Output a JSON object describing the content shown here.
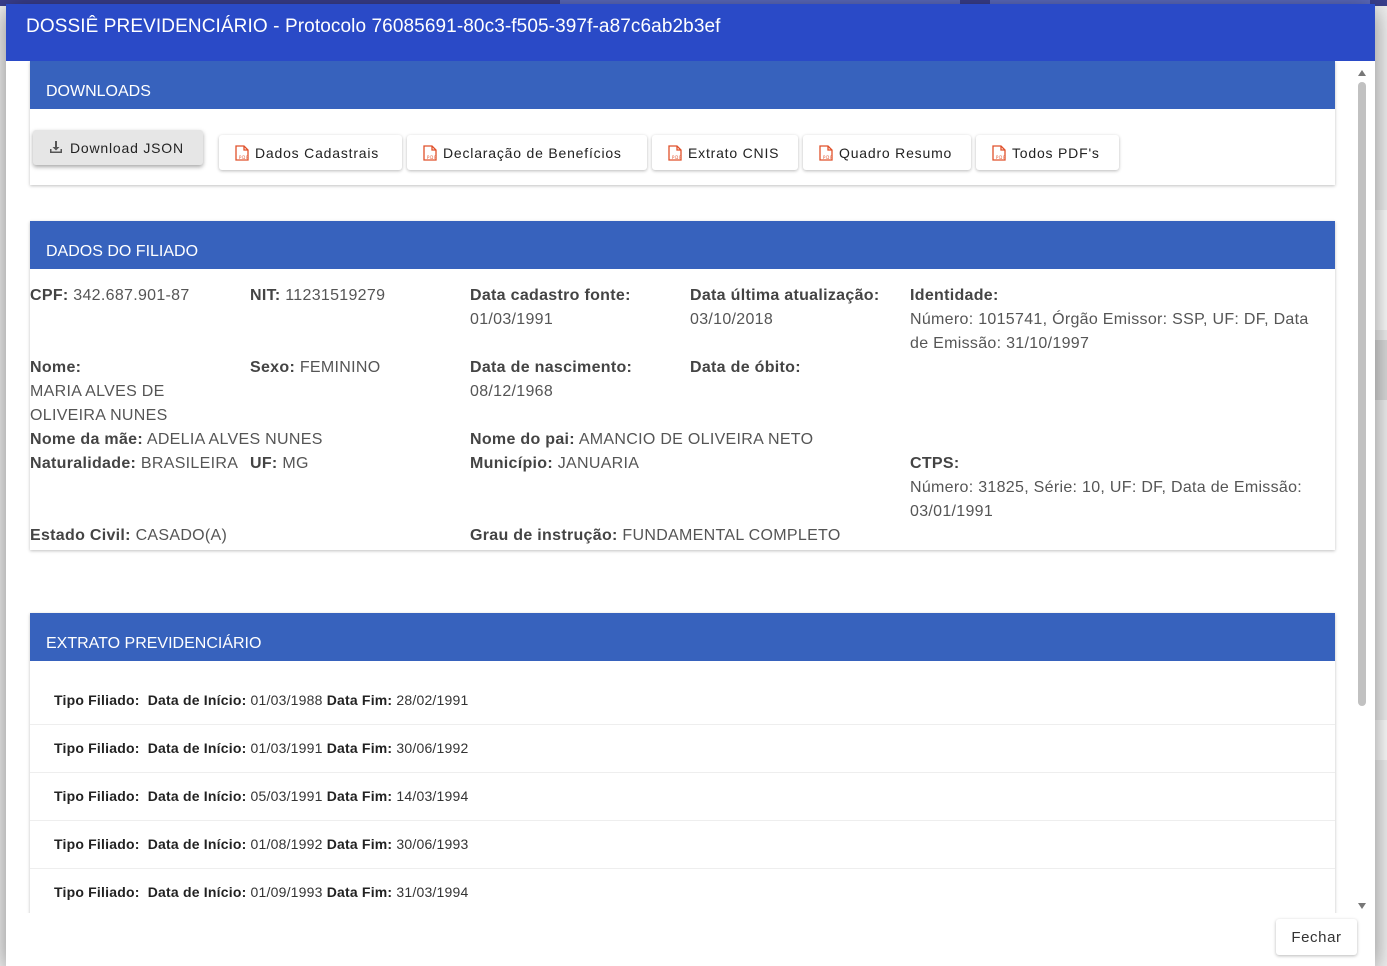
{
  "dialog": {
    "title": "DOSSIÊ PREVIDENCIÁRIO - Protocolo 76085691-80c3-f505-397f-a87c6ab2b3ef",
    "close_label": "Fechar"
  },
  "downloads": {
    "title": "DOWNLOADS",
    "buttons": [
      {
        "label": "Download JSON",
        "icon": "download-icon"
      },
      {
        "label": "Dados Cadastrais",
        "icon": "pdf-icon"
      },
      {
        "label": "Declaração de Benefícios",
        "icon": "pdf-icon"
      },
      {
        "label": "Extrato CNIS",
        "icon": "pdf-icon"
      },
      {
        "label": "Quadro Resumo",
        "icon": "pdf-icon"
      },
      {
        "label": "Todos PDF's",
        "icon": "pdf-icon"
      }
    ]
  },
  "filiado": {
    "title": "DADOS DO FILIADO",
    "cpf": {
      "label": "CPF:",
      "value": "342.687.901-87"
    },
    "nit": {
      "label": "NIT:",
      "value": "11231519279"
    },
    "data_cadastro": {
      "label": "Data cadastro fonte:",
      "value": "01/03/1991"
    },
    "data_atualizacao": {
      "label": "Data última atualização:",
      "value": "03/10/2018"
    },
    "identidade": {
      "label": "Identidade:",
      "value": "Número: 1015741, Órgão Emissor: SSP, UF: DF, Data de Emissão: 31/10/1997"
    },
    "nome": {
      "label": "Nome:",
      "value": "MARIA ALVES DE OLIVEIRA NUNES"
    },
    "sexo": {
      "label": "Sexo:",
      "value": "FEMININO"
    },
    "data_nascimento": {
      "label": "Data de nascimento:",
      "value": "08/12/1968"
    },
    "data_obito": {
      "label": "Data de óbito:",
      "value": ""
    },
    "nome_mae": {
      "label": "Nome da mãe:",
      "value": "ADELIA ALVES NUNES"
    },
    "nome_pai": {
      "label": "Nome do pai:",
      "value": "AMANCIO DE OLIVEIRA NETO"
    },
    "naturalidade": {
      "label": "Naturalidade:",
      "value": "BRASILEIRA"
    },
    "uf": {
      "label": "UF:",
      "value": "MG"
    },
    "municipio": {
      "label": "Município:",
      "value": "JANUARIA"
    },
    "ctps": {
      "label": "CTPS:",
      "value": "Número: 31825, Série: 10, UF: DF, Data de Emissão: 03/01/1991"
    },
    "estado_civil": {
      "label": "Estado Civil:",
      "value": "CASADO(A)"
    },
    "grau_instrucao": {
      "label": "Grau de instrução:",
      "value": "FUNDAMENTAL COMPLETO"
    }
  },
  "extrato": {
    "title": "EXTRATO PREVIDENCIÁRIO",
    "labels": {
      "tipo": "Tipo Filiado:",
      "inicio": "Data de Início:",
      "fim": "Data Fim:"
    },
    "rows": [
      {
        "inicio": "01/03/1988",
        "fim": "28/02/1991"
      },
      {
        "inicio": "01/03/1991",
        "fim": "30/06/1992"
      },
      {
        "inicio": "05/03/1991",
        "fim": "14/03/1994"
      },
      {
        "inicio": "01/08/1992",
        "fim": "30/06/1993"
      },
      {
        "inicio": "01/09/1993",
        "fim": "31/03/1994"
      }
    ]
  }
}
